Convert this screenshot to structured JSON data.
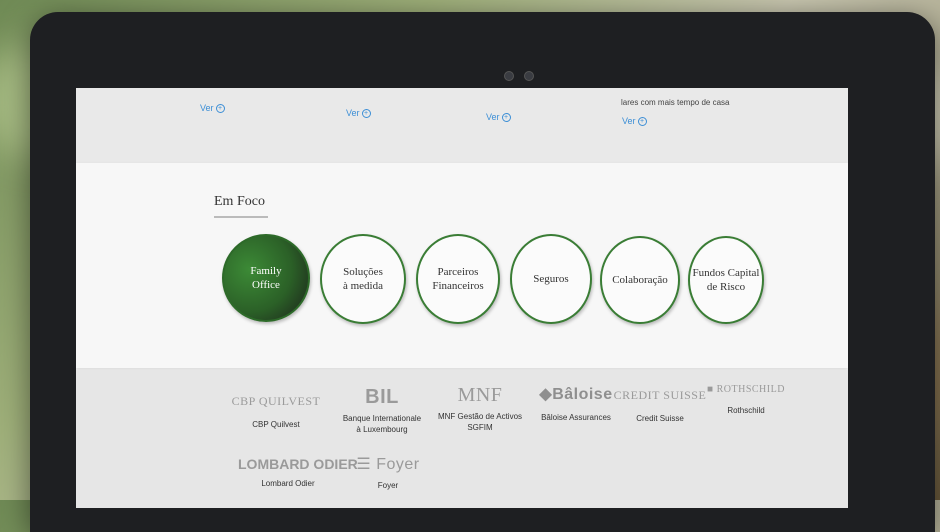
{
  "top": {
    "ver_links": [
      "Ver",
      "Ver",
      "Ver",
      "Ver"
    ],
    "snippet": "lares com mais tempo de casa"
  },
  "section": {
    "title": "Em Foco",
    "items": [
      {
        "label_1": "Family",
        "label_2": "Office",
        "active": true
      },
      {
        "label_1": "Soluções",
        "label_2": "à medida"
      },
      {
        "label_1": "Parceiros",
        "label_2": "Financeiros"
      },
      {
        "label_1": "Seguros",
        "label_2": ""
      },
      {
        "label_1": "Colaboração",
        "label_2": ""
      },
      {
        "label_1": "Fundos Capital",
        "label_2": "de Risco"
      }
    ]
  },
  "partners": [
    {
      "logo": "CBP QUILVEST",
      "name_1": "CBP Quilvest",
      "name_2": ""
    },
    {
      "logo": "BIL",
      "name_1": "Banque Internationale",
      "name_2": "à Luxembourg"
    },
    {
      "logo": "MNF",
      "name_1": "MNF Gestão de Activos",
      "name_2": "SGFIM"
    },
    {
      "logo": "Bâloise",
      "name_1": "Bâloise Assurances",
      "name_2": ""
    },
    {
      "logo": "CREDIT SUISSE",
      "name_1": "Credit Suisse",
      "name_2": ""
    },
    {
      "logo": "ROTHSCHILD",
      "name_1": "Rothschild",
      "name_2": ""
    },
    {
      "logo": "LOMBARD ODIER",
      "name_1": "Lombard Odier",
      "name_2": ""
    },
    {
      "logo": "Foyer",
      "name_1": "Foyer",
      "name_2": ""
    }
  ]
}
